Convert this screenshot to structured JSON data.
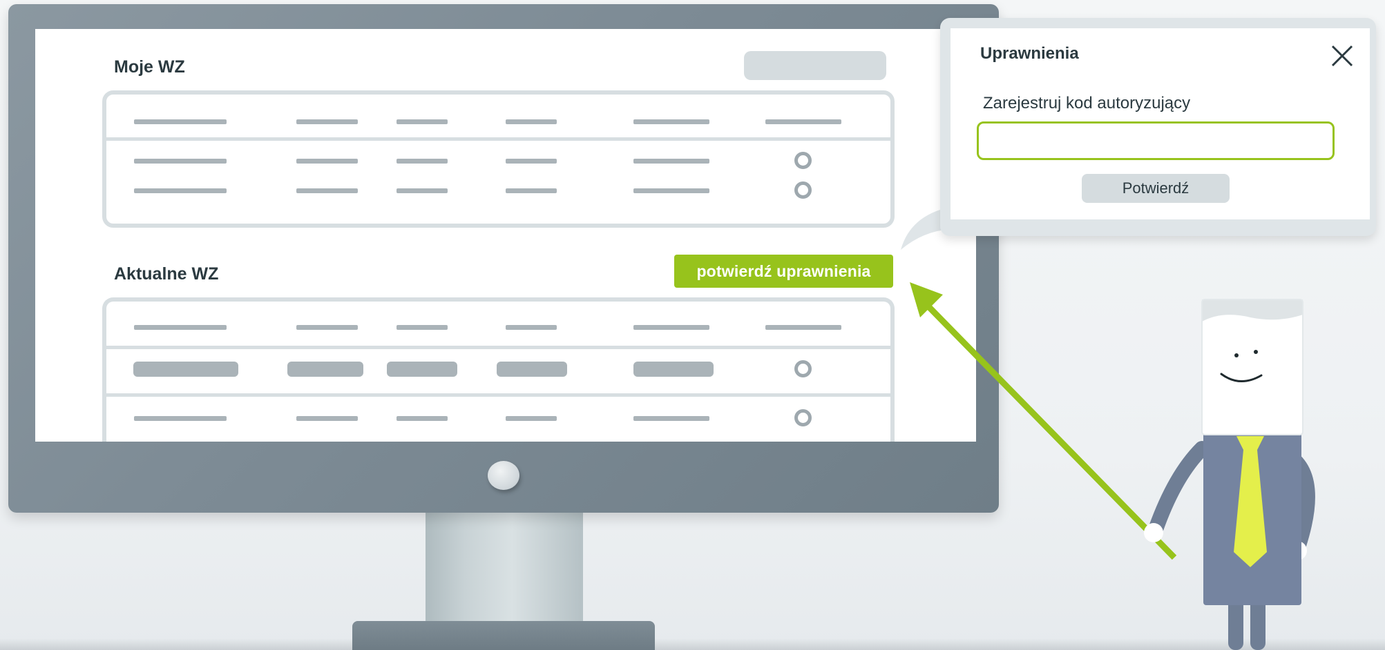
{
  "screen": {
    "section1": {
      "title": "Moje WZ"
    },
    "section2": {
      "title": "Aktualne WZ",
      "confirm_button": "potwierdź uprawnienia"
    }
  },
  "dialog": {
    "title": "Uprawnienia",
    "field_label": "Zarejestruj kod autoryzujący",
    "input_value": "",
    "confirm_label": "Potwierdź"
  },
  "colors": {
    "accent": "#97c31c",
    "title_text": "#2b3a40",
    "placeholder_bar": "#aab3b8",
    "table_border": "#d7dee1"
  },
  "icons": [
    "close-icon",
    "radio-icon"
  ]
}
